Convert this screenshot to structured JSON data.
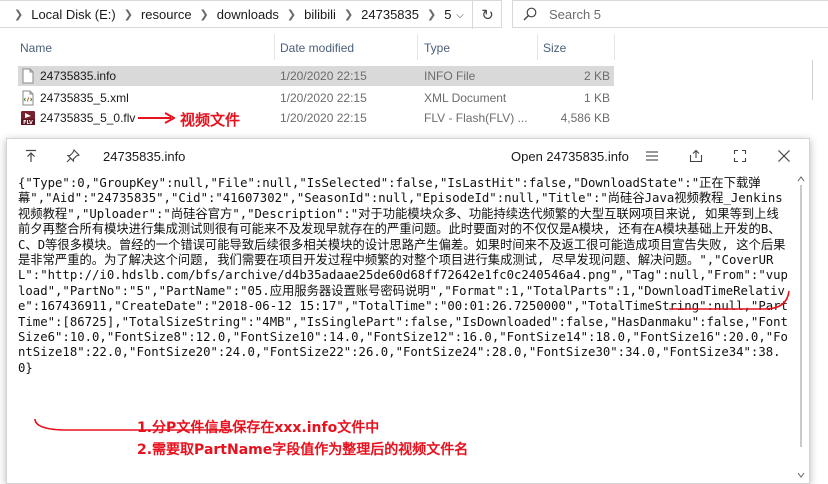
{
  "address_bar": {
    "crumbs": [
      "Local Disk (E:)",
      "resource",
      "downloads",
      "bilibili",
      "24735835",
      "5"
    ],
    "search_placeholder": "Search 5"
  },
  "columns": {
    "name": "Name",
    "date": "Date modified",
    "type": "Type",
    "size": "Size"
  },
  "files": [
    {
      "name": "24735835.info",
      "date": "1/20/2020 22:15",
      "type": "INFO File",
      "size": "2 KB",
      "icon": "document-icon",
      "selected": true
    },
    {
      "name": "24735835_5.xml",
      "date": "1/20/2020 22:15",
      "type": "XML Document",
      "size": "1 KB",
      "icon": "xml-file-icon",
      "selected": false
    },
    {
      "name": "24735835_5_0.flv",
      "date": "1/20/2020 22:15",
      "type": "FLV - Flash(FLV) ...",
      "size": "4,586 KB",
      "icon": "flv-file-icon",
      "selected": false
    }
  ],
  "annotation_video": "视频文件",
  "preview": {
    "title": "24735835.info",
    "open_button": "Open 24735835.info",
    "content": "{\"Type\":0,\"GroupKey\":null,\"File\":null,\"IsSelected\":false,\"IsLastHit\":false,\"DownloadState\":\"正在下载弹幕\",\"Aid\":\"24735835\",\"Cid\":\"41607302\",\"SeasonId\":null,\"EpisodeId\":null,\"Title\":\"尚硅谷Java视频教程_Jenkins视频教程\",\"Uploader\":\"尚硅谷官方\",\"Description\":\"对于功能模块众多、功能持续迭代频繁的大型互联网项目来说, 如果等到上线前夕再整合所有模块进行集成测试则很有可能来不及发现早就存在的严重问题。此时要面对的不仅仅是A模块, 还有在A模块基础上开发的B、C、D等很多模块。曾经的一个错误可能导致后续很多相关模块的设计思路产生偏差。如果时间来不及返工很可能造成项目宣告失败, 这个后果是非常严重的。为了解决这个问题, 我们需要在项目开发过程中频繁的对整个项目进行集成测试, 尽早发现问题、解决问题。\",\"CoverURL\":\"http://i0.hdslb.com/bfs/archive/d4b35adaae25de60d68ff72642e1fc0c240546a4.png\",\"Tag\":null,\"From\":\"vupload\",\"PartNo\":\"5\",\"PartName\":\"05.应用服务器设置账号密码说明\",\"Format\":1,\"TotalParts\":1,\"DownloadTimeRelative\":167436911,\"CreateDate\":\"2018-06-12 15:17\",\"TotalTime\":\"00:01:26.7250000\",\"TotalTimeString\":null,\"PartTime\":[86725],\"TotalSizeString\":\"4MB\",\"IsSinglePart\":false,\"IsDownloaded\":false,\"HasDanmaku\":false,\"FontSize6\":10.0,\"FontSize8\":12.0,\"FontSize10\":14.0,\"FontSize12\":16.0,\"FontSize14\":18.0,\"FontSize16\":20.0,\"FontSize18\":22.0,\"FontSize20\":24.0,\"FontSize22\":26.0,\"FontSize24\":28.0,\"FontSize30\":34.0,\"FontSize34\":38.0}",
    "notes": [
      "1.分P文件信息保存在xxx.info文件中",
      "2.需要取PartName字段值作为整理后的视频文件名"
    ]
  },
  "colors": {
    "annotation_red": "#e8111e",
    "selected_row": "#d9d9d9",
    "header_text": "#4c607a"
  }
}
